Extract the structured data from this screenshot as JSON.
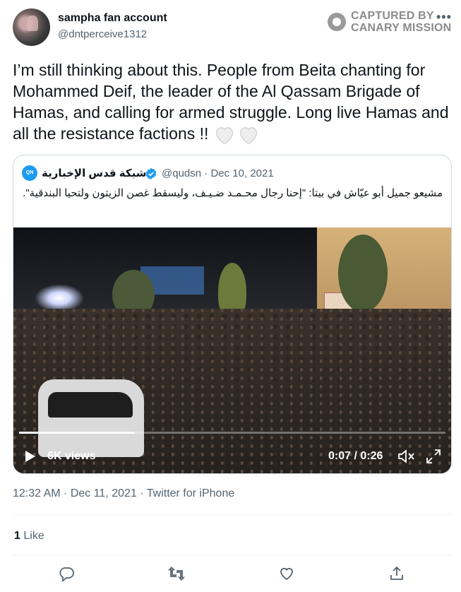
{
  "author": {
    "display_name": "sampha fan account",
    "handle": "@dntperceive1312"
  },
  "watermark": {
    "line1": "CAPTURED BY",
    "line2": "CANARY MISSION"
  },
  "more_icon": "more-icon",
  "tweet": {
    "text": "I’m still thinking about this. People from Beita chanting for Mohammed Deif, the leader of the Al Qassam Brigade of Hamas, and calling for armed struggle. Long live Hamas and all the resistance factions !!"
  },
  "quote": {
    "name": "شبكة قدس الإخبارية",
    "handle": "@qudsn",
    "separator": "·",
    "date": "Dec 10, 2021",
    "text": "مشيعو جميل أبو عيّاش في بيتا: \"إحنا رجال محـمـد ضـيـف، وليسقط غصن الزيتون ولتحيا البندقية\".",
    "video": {
      "views": "6K views",
      "time": "0:07 / 0:26",
      "progress": 0.27
    }
  },
  "meta": {
    "timestamp": "12:32 AM · Dec 11, 2021 · Twitter for iPhone"
  },
  "stats": {
    "likes_count": "1",
    "likes_label": "Like"
  },
  "colors": {
    "text": "#0f1419",
    "muted": "#536471",
    "accent": "#1d9bf0",
    "border": "#cfd9de"
  }
}
